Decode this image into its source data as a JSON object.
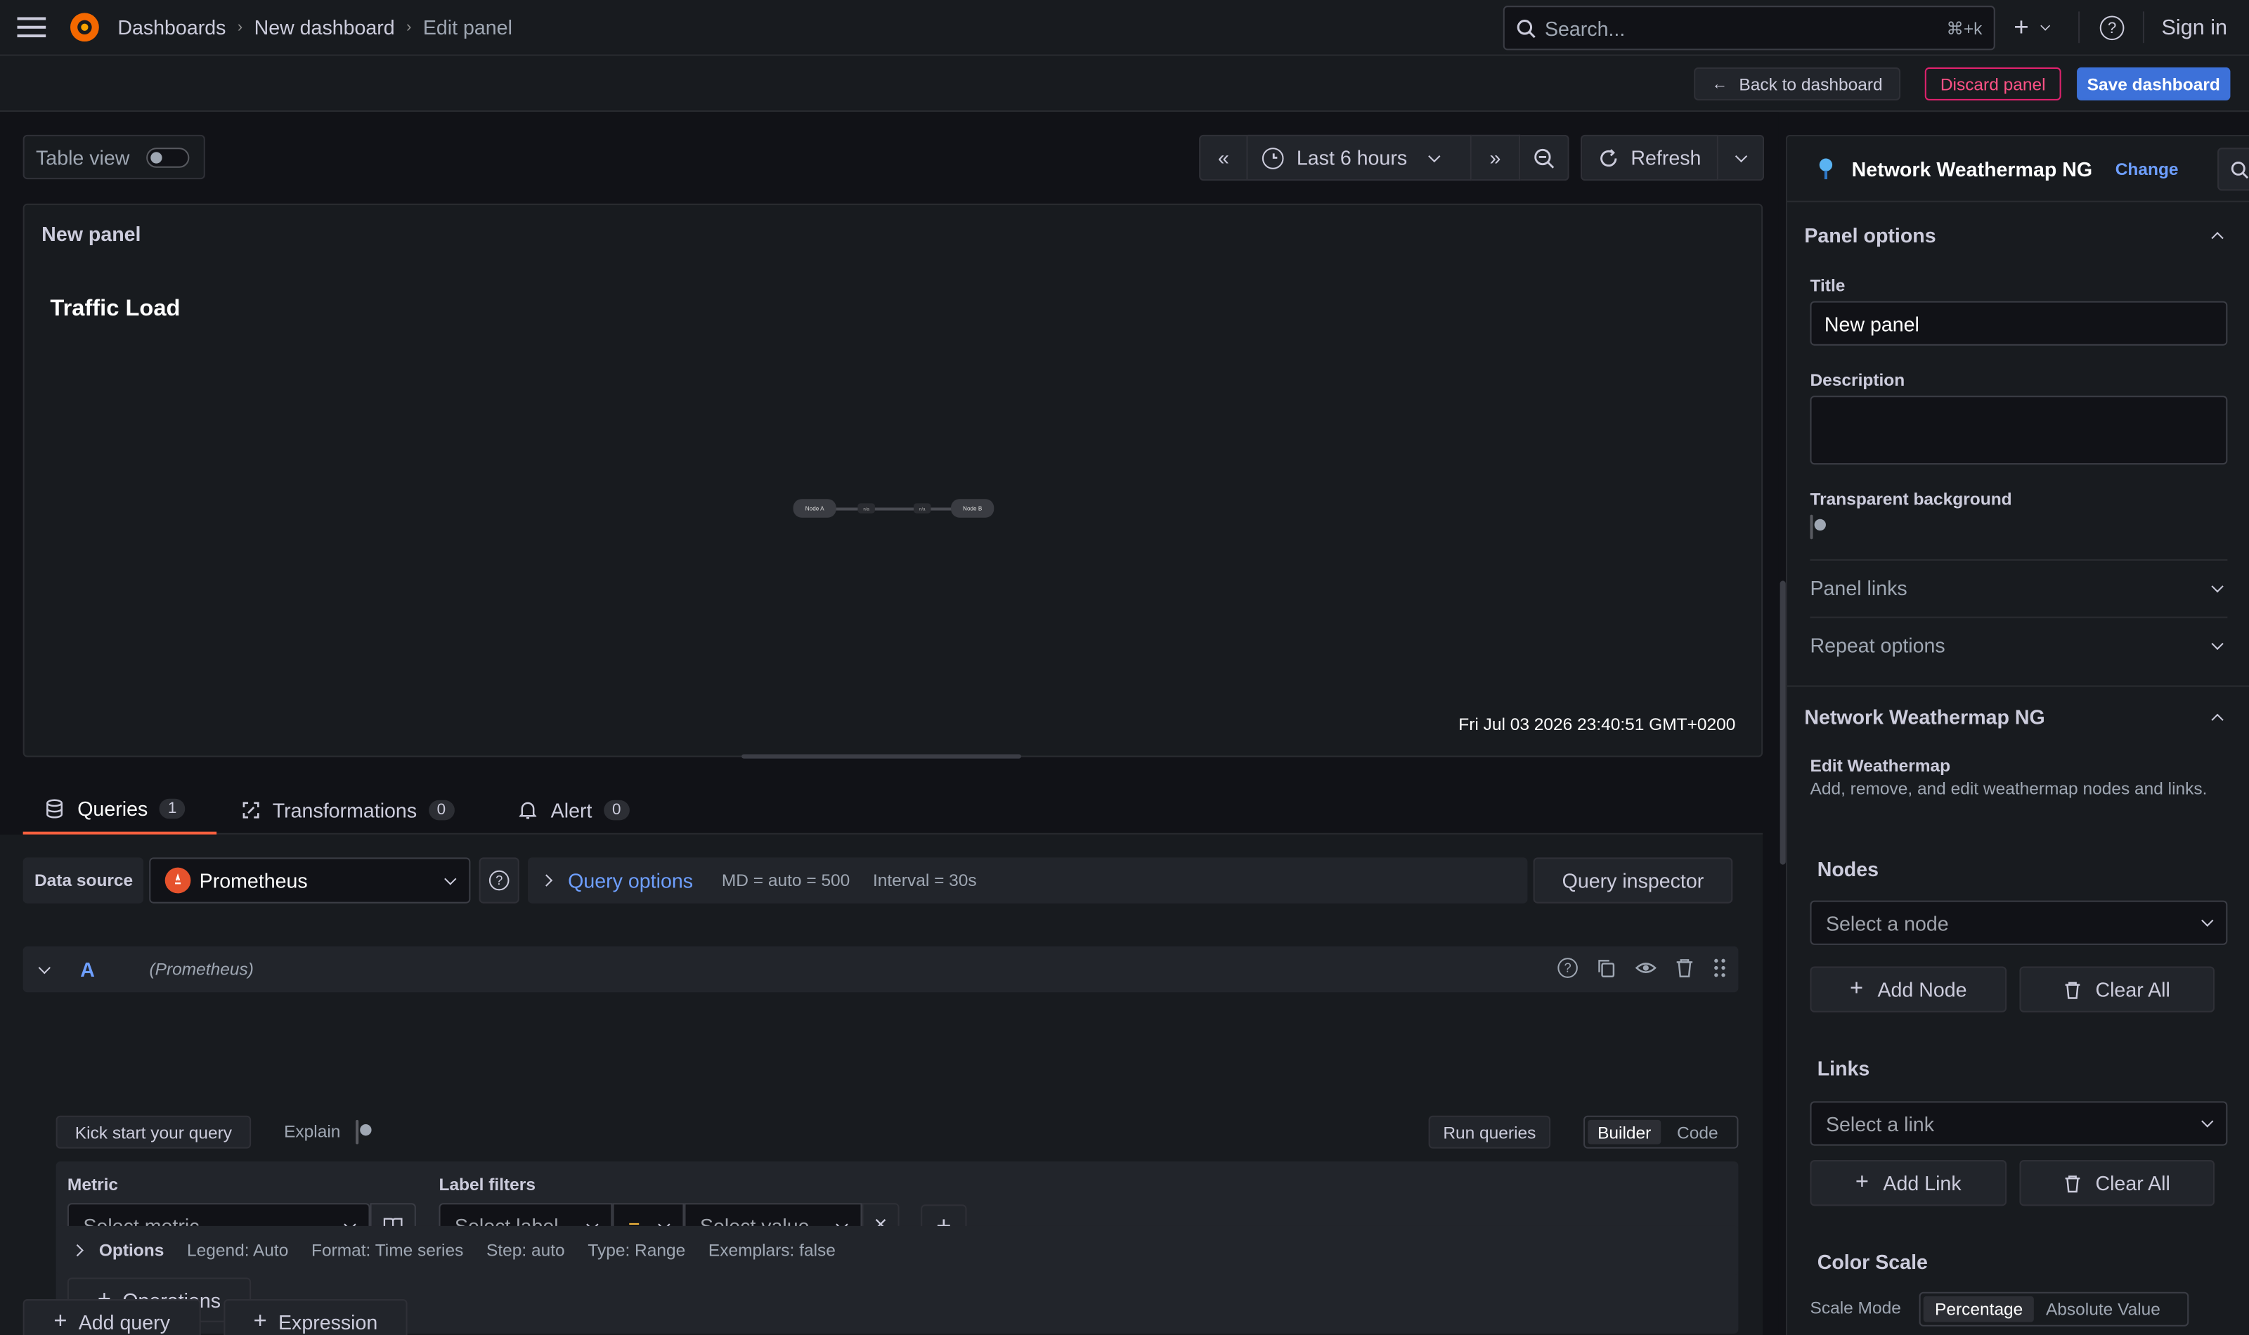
{
  "topbar": {
    "breadcrumbs": [
      "Dashboards",
      "New dashboard",
      "Edit panel"
    ],
    "search_placeholder": "Search...",
    "search_shortcut": "⌘+k",
    "sign_in": "Sign in"
  },
  "actions": {
    "back": "Back to dashboard",
    "discard": "Discard panel",
    "save": "Save dashboard"
  },
  "toolbar": {
    "table_view": "Table view",
    "time_range": "Last 6 hours",
    "refresh": "Refresh"
  },
  "panel": {
    "header": "New panel",
    "title": "Traffic Load",
    "timestamp": "Fri Jul 03 2026 23:40:51 GMT+0200",
    "node_a": "Node A",
    "node_b": "Node B",
    "link_a_label": "n/a",
    "link_b_label": "n/a"
  },
  "tabs": [
    {
      "label": "Queries",
      "count": "1"
    },
    {
      "label": "Transformations",
      "count": "0"
    },
    {
      "label": "Alert",
      "count": "0"
    }
  ],
  "query_bar": {
    "data_source_label": "Data source",
    "data_source": "Prometheus",
    "query_options": "Query options",
    "md": "MD = auto = 500",
    "interval": "Interval = 30s",
    "inspector": "Query inspector"
  },
  "query": {
    "ref": "A",
    "ds": "(Prometheus)",
    "kick_start": "Kick start your query",
    "explain": "Explain",
    "run": "Run queries",
    "builder": "Builder",
    "code": "Code",
    "metric_label": "Metric",
    "metric_placeholder": "Select metric",
    "label_filters": "Label filters",
    "select_label": "Select label",
    "operator": "=",
    "select_value": "Select value",
    "operations": "Operations",
    "options_label": "Options",
    "options": [
      "Legend: Auto",
      "Format: Time series",
      "Step: auto",
      "Type: Range",
      "Exemplars: false"
    ]
  },
  "bottom": {
    "add_query": "Add query",
    "expression": "Expression"
  },
  "sidebar": {
    "viz_name": "Network Weathermap NG",
    "change": "Change",
    "panel_options": "Panel options",
    "title_label": "Title",
    "title_value": "New panel",
    "description_label": "Description",
    "transparent_label": "Transparent background",
    "panel_links": "Panel links",
    "repeat_options": "Repeat options",
    "plugin_section": "Network Weathermap NG",
    "edit_title": "Edit Weathermap",
    "edit_desc": "Add, remove, and edit weathermap nodes and links.",
    "nodes": "Nodes",
    "select_node": "Select a node",
    "add_node": "Add Node",
    "clear_all": "Clear All",
    "links": "Links",
    "select_link": "Select a link",
    "add_link": "Add Link",
    "color_scale": "Color Scale",
    "scale_mode": "Scale Mode",
    "percentage": "Percentage",
    "absolute": "Absolute Value"
  },
  "colors": {
    "bg": "#111217",
    "panel": "#181b1f",
    "accent": "#6e9fff",
    "save": "#3d71d9",
    "discard": "#e0226e",
    "tab_active": "#f55f3e"
  }
}
